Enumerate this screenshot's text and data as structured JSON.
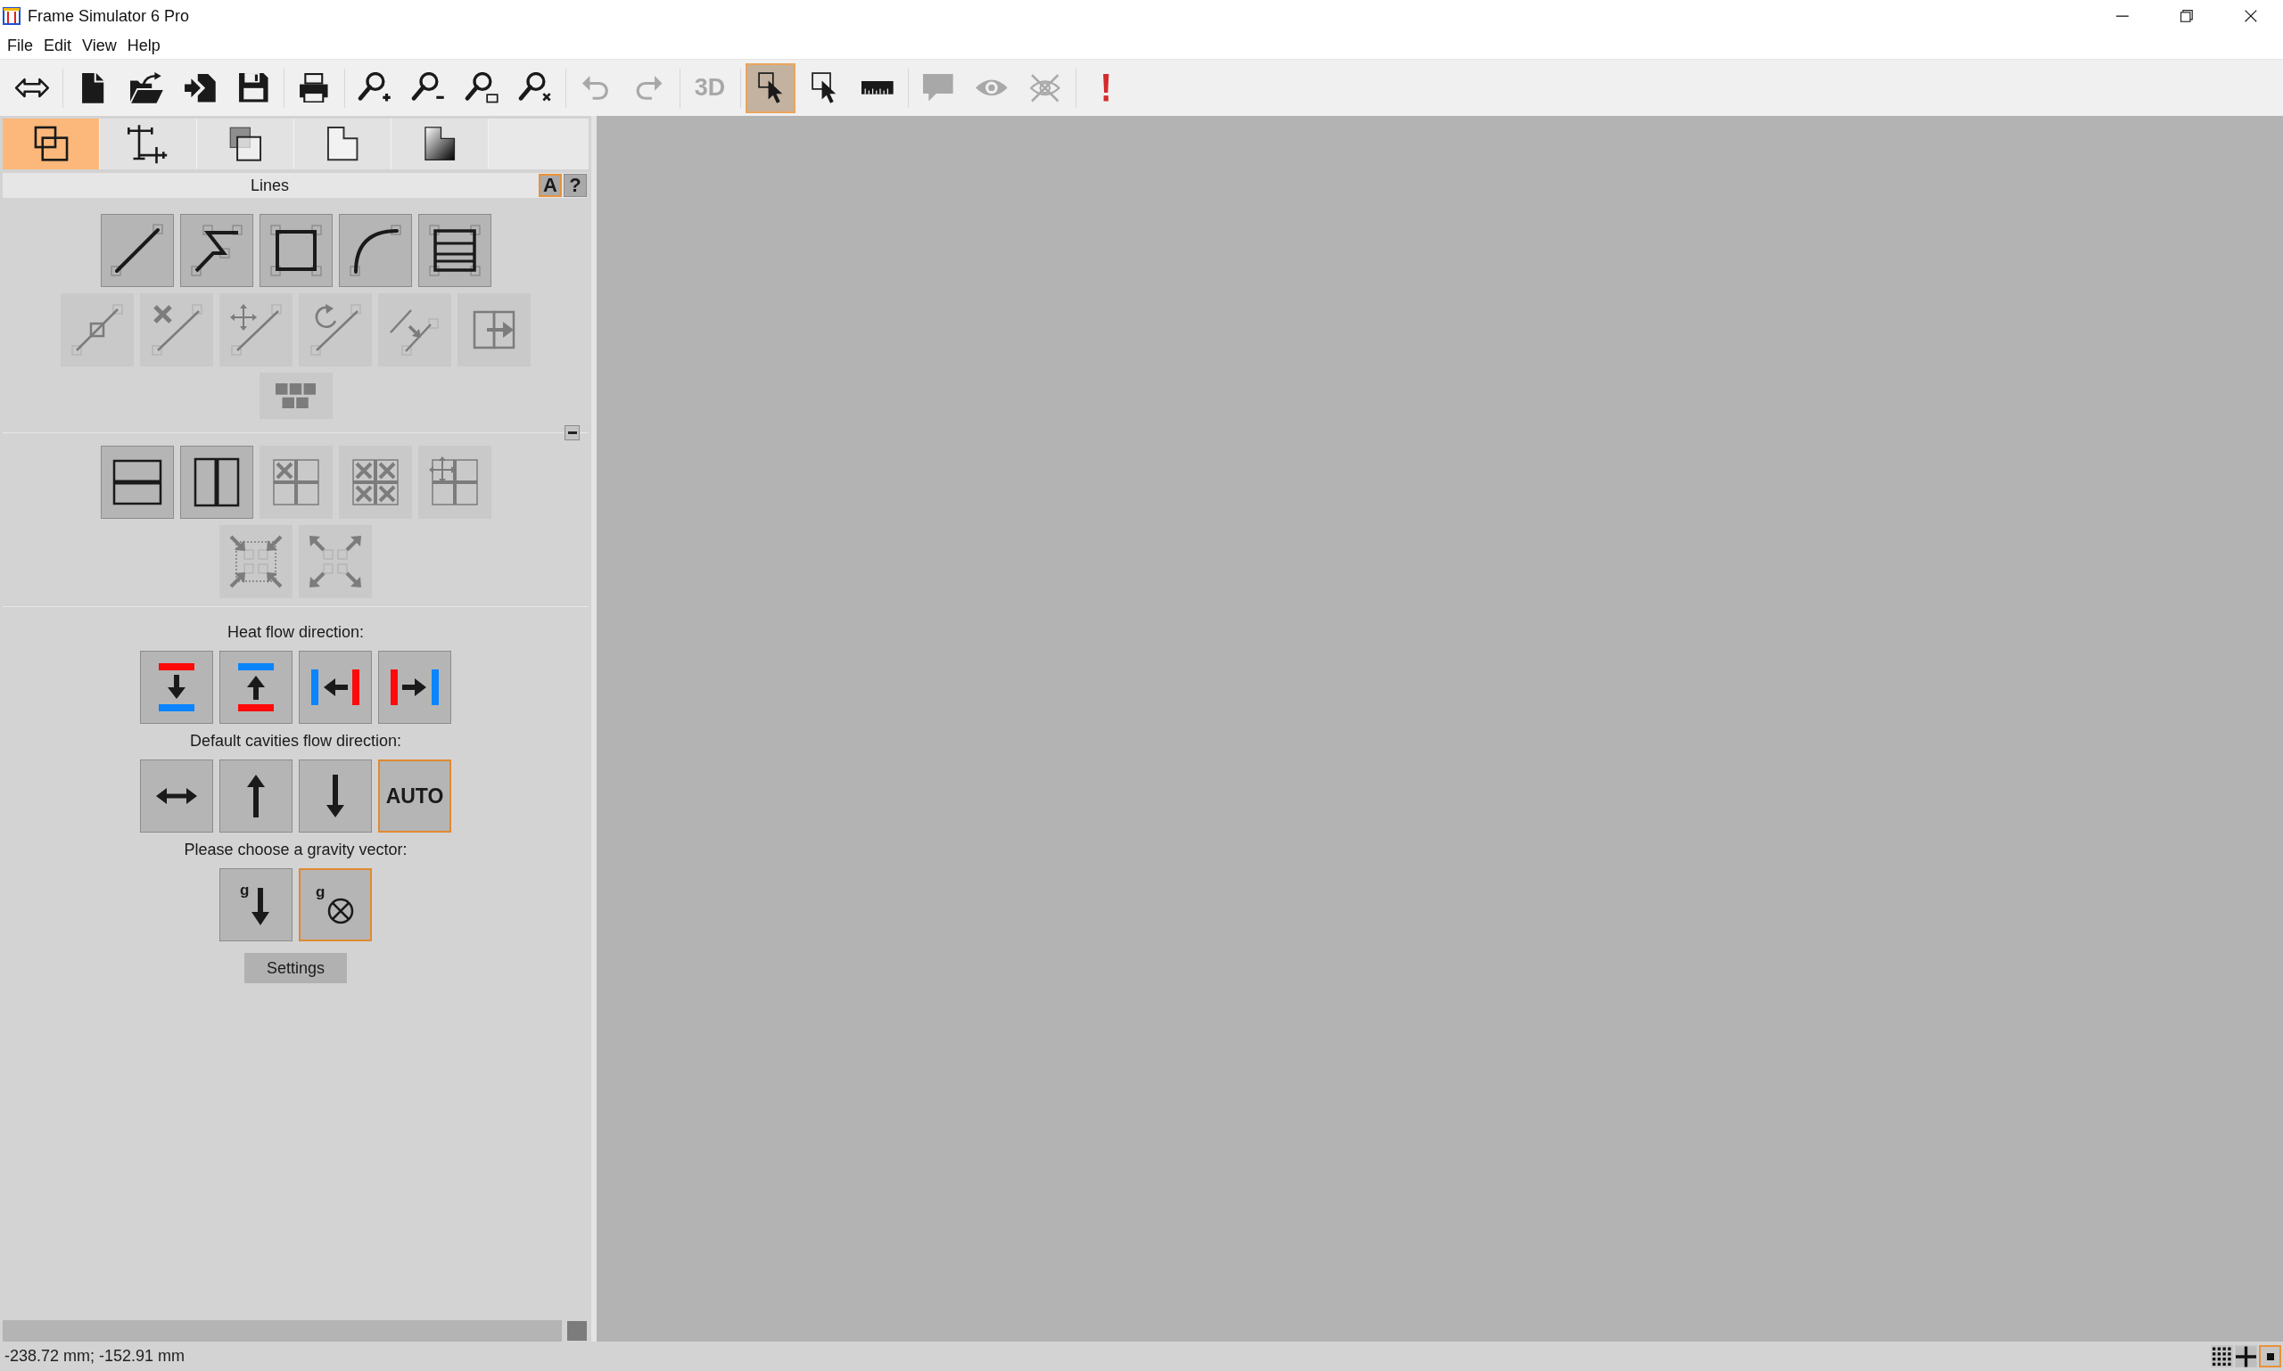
{
  "window": {
    "title": "Frame Simulator 6 Pro"
  },
  "menu": [
    {
      "label": "File"
    },
    {
      "label": "Edit"
    },
    {
      "label": "View"
    },
    {
      "label": "Help"
    }
  ],
  "toolbar": {
    "groups": [
      [
        {
          "kind": "fit",
          "disabled": false,
          "selected": false
        }
      ],
      [
        {
          "kind": "new",
          "disabled": false,
          "selected": false
        },
        {
          "kind": "open",
          "disabled": false,
          "selected": false
        },
        {
          "kind": "import",
          "disabled": false,
          "selected": false
        },
        {
          "kind": "save",
          "disabled": false,
          "selected": false
        }
      ],
      [
        {
          "kind": "print",
          "disabled": false,
          "selected": false
        }
      ],
      [
        {
          "kind": "zoom_in",
          "disabled": false,
          "selected": false
        },
        {
          "kind": "zoom_out",
          "disabled": false,
          "selected": false
        },
        {
          "kind": "zoom_window",
          "disabled": false,
          "selected": false
        },
        {
          "kind": "zoom_clear",
          "disabled": false,
          "selected": false
        }
      ],
      [
        {
          "kind": "undo",
          "disabled": true,
          "selected": false
        },
        {
          "kind": "redo",
          "disabled": true,
          "selected": false
        }
      ],
      [
        {
          "kind": "text",
          "label": "3D",
          "disabled": true,
          "selected": false
        }
      ],
      [
        {
          "kind": "select",
          "disabled": false,
          "selected": true
        },
        {
          "kind": "select_window",
          "disabled": false,
          "selected": false
        },
        {
          "kind": "measure",
          "disabled": false,
          "selected": false
        }
      ],
      [
        {
          "kind": "comment",
          "disabled": true,
          "selected": false
        },
        {
          "kind": "eye",
          "disabled": true,
          "selected": false
        },
        {
          "kind": "hide",
          "disabled": true,
          "selected": false
        }
      ],
      [
        {
          "kind": "warning",
          "disabled": false,
          "selected": false
        }
      ]
    ]
  },
  "panel": {
    "tabs": [
      {
        "kind": "geometry",
        "selected": true
      },
      {
        "kind": "dimensions",
        "selected": false
      },
      {
        "kind": "materials",
        "selected": false
      },
      {
        "kind": "boundary",
        "selected": false
      },
      {
        "kind": "gradient",
        "selected": false
      }
    ],
    "lines": {
      "title": "Lines",
      "buttons": [
        {
          "label": "A",
          "selected": true
        },
        {
          "label": "?",
          "selected": false
        }
      ],
      "rows": [
        [
          {
            "kind": "line",
            "disabled": false
          },
          {
            "kind": "polyline",
            "disabled": false
          },
          {
            "kind": "rectangle",
            "disabled": false
          },
          {
            "kind": "arc",
            "disabled": false
          },
          {
            "kind": "striped",
            "disabled": false
          }
        ],
        [
          {
            "kind": "midpoint",
            "disabled": true
          },
          {
            "kind": "cross_line",
            "disabled": true
          },
          {
            "kind": "move_line",
            "disabled": true
          },
          {
            "kind": "rotate_line",
            "disabled": true
          },
          {
            "kind": "offset_line",
            "disabled": true
          },
          {
            "kind": "rect_arrow",
            "disabled": true
          }
        ],
        [
          {
            "kind": "bricks",
            "disabled": true
          }
        ]
      ]
    },
    "grid": {
      "rows": [
        [
          {
            "kind": "split_h",
            "disabled": false
          },
          {
            "kind": "split_v",
            "disabled": false
          },
          {
            "kind": "grid_cross",
            "disabled": true
          },
          {
            "kind": "grid_crosses",
            "disabled": true
          },
          {
            "kind": "grid_move",
            "disabled": true
          }
        ],
        [
          {
            "kind": "shrink",
            "disabled": true
          },
          {
            "kind": "expand",
            "disabled": true
          }
        ]
      ]
    },
    "heat_flow": {
      "label": "Heat flow direction:",
      "options": [
        {
          "kind": "down",
          "selected": false
        },
        {
          "kind": "up",
          "selected": false
        },
        {
          "kind": "left",
          "selected": false
        },
        {
          "kind": "right",
          "selected": false
        }
      ]
    },
    "cavities_flow": {
      "label": "Default cavities flow direction:",
      "options": [
        {
          "kind": "horizontal",
          "selected": false
        },
        {
          "kind": "up",
          "selected": false
        },
        {
          "kind": "down",
          "selected": false
        },
        {
          "kind": "auto",
          "label": "AUTO",
          "selected": true
        }
      ]
    },
    "gravity": {
      "label": "Please choose a gravity vector:",
      "options": [
        {
          "kind": "down",
          "symbol": "g",
          "selected": false
        },
        {
          "kind": "into_page",
          "symbol": "g",
          "selected": true
        }
      ]
    },
    "settings": {
      "label": "Settings"
    }
  },
  "status_bar": {
    "coordinates": "-238.72 mm; -152.91 mm",
    "view_modes": [
      {
        "kind": "dots",
        "selected": false
      },
      {
        "kind": "cross",
        "selected": false
      },
      {
        "kind": "point",
        "selected": true
      }
    ]
  }
}
